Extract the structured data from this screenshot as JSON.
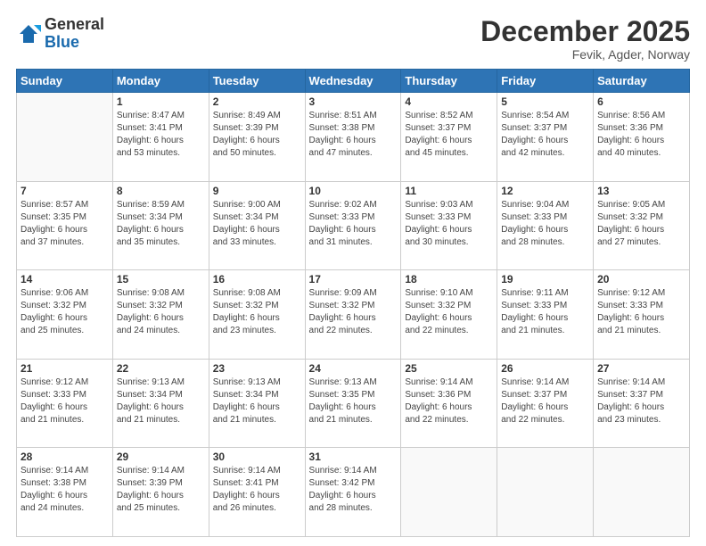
{
  "logo": {
    "line1": "General",
    "line2": "Blue"
  },
  "header": {
    "month": "December 2025",
    "location": "Fevik, Agder, Norway"
  },
  "days_of_week": [
    "Sunday",
    "Monday",
    "Tuesday",
    "Wednesday",
    "Thursday",
    "Friday",
    "Saturday"
  ],
  "weeks": [
    [
      {
        "day": "",
        "info": ""
      },
      {
        "day": "1",
        "info": "Sunrise: 8:47 AM\nSunset: 3:41 PM\nDaylight: 6 hours\nand 53 minutes."
      },
      {
        "day": "2",
        "info": "Sunrise: 8:49 AM\nSunset: 3:39 PM\nDaylight: 6 hours\nand 50 minutes."
      },
      {
        "day": "3",
        "info": "Sunrise: 8:51 AM\nSunset: 3:38 PM\nDaylight: 6 hours\nand 47 minutes."
      },
      {
        "day": "4",
        "info": "Sunrise: 8:52 AM\nSunset: 3:37 PM\nDaylight: 6 hours\nand 45 minutes."
      },
      {
        "day": "5",
        "info": "Sunrise: 8:54 AM\nSunset: 3:37 PM\nDaylight: 6 hours\nand 42 minutes."
      },
      {
        "day": "6",
        "info": "Sunrise: 8:56 AM\nSunset: 3:36 PM\nDaylight: 6 hours\nand 40 minutes."
      }
    ],
    [
      {
        "day": "7",
        "info": "Sunrise: 8:57 AM\nSunset: 3:35 PM\nDaylight: 6 hours\nand 37 minutes."
      },
      {
        "day": "8",
        "info": "Sunrise: 8:59 AM\nSunset: 3:34 PM\nDaylight: 6 hours\nand 35 minutes."
      },
      {
        "day": "9",
        "info": "Sunrise: 9:00 AM\nSunset: 3:34 PM\nDaylight: 6 hours\nand 33 minutes."
      },
      {
        "day": "10",
        "info": "Sunrise: 9:02 AM\nSunset: 3:33 PM\nDaylight: 6 hours\nand 31 minutes."
      },
      {
        "day": "11",
        "info": "Sunrise: 9:03 AM\nSunset: 3:33 PM\nDaylight: 6 hours\nand 30 minutes."
      },
      {
        "day": "12",
        "info": "Sunrise: 9:04 AM\nSunset: 3:33 PM\nDaylight: 6 hours\nand 28 minutes."
      },
      {
        "day": "13",
        "info": "Sunrise: 9:05 AM\nSunset: 3:32 PM\nDaylight: 6 hours\nand 27 minutes."
      }
    ],
    [
      {
        "day": "14",
        "info": "Sunrise: 9:06 AM\nSunset: 3:32 PM\nDaylight: 6 hours\nand 25 minutes."
      },
      {
        "day": "15",
        "info": "Sunrise: 9:08 AM\nSunset: 3:32 PM\nDaylight: 6 hours\nand 24 minutes."
      },
      {
        "day": "16",
        "info": "Sunrise: 9:08 AM\nSunset: 3:32 PM\nDaylight: 6 hours\nand 23 minutes."
      },
      {
        "day": "17",
        "info": "Sunrise: 9:09 AM\nSunset: 3:32 PM\nDaylight: 6 hours\nand 22 minutes."
      },
      {
        "day": "18",
        "info": "Sunrise: 9:10 AM\nSunset: 3:32 PM\nDaylight: 6 hours\nand 22 minutes."
      },
      {
        "day": "19",
        "info": "Sunrise: 9:11 AM\nSunset: 3:33 PM\nDaylight: 6 hours\nand 21 minutes."
      },
      {
        "day": "20",
        "info": "Sunrise: 9:12 AM\nSunset: 3:33 PM\nDaylight: 6 hours\nand 21 minutes."
      }
    ],
    [
      {
        "day": "21",
        "info": "Sunrise: 9:12 AM\nSunset: 3:33 PM\nDaylight: 6 hours\nand 21 minutes."
      },
      {
        "day": "22",
        "info": "Sunrise: 9:13 AM\nSunset: 3:34 PM\nDaylight: 6 hours\nand 21 minutes."
      },
      {
        "day": "23",
        "info": "Sunrise: 9:13 AM\nSunset: 3:34 PM\nDaylight: 6 hours\nand 21 minutes."
      },
      {
        "day": "24",
        "info": "Sunrise: 9:13 AM\nSunset: 3:35 PM\nDaylight: 6 hours\nand 21 minutes."
      },
      {
        "day": "25",
        "info": "Sunrise: 9:14 AM\nSunset: 3:36 PM\nDaylight: 6 hours\nand 22 minutes."
      },
      {
        "day": "26",
        "info": "Sunrise: 9:14 AM\nSunset: 3:37 PM\nDaylight: 6 hours\nand 22 minutes."
      },
      {
        "day": "27",
        "info": "Sunrise: 9:14 AM\nSunset: 3:37 PM\nDaylight: 6 hours\nand 23 minutes."
      }
    ],
    [
      {
        "day": "28",
        "info": "Sunrise: 9:14 AM\nSunset: 3:38 PM\nDaylight: 6 hours\nand 24 minutes."
      },
      {
        "day": "29",
        "info": "Sunrise: 9:14 AM\nSunset: 3:39 PM\nDaylight: 6 hours\nand 25 minutes."
      },
      {
        "day": "30",
        "info": "Sunrise: 9:14 AM\nSunset: 3:41 PM\nDaylight: 6 hours\nand 26 minutes."
      },
      {
        "day": "31",
        "info": "Sunrise: 9:14 AM\nSunset: 3:42 PM\nDaylight: 6 hours\nand 28 minutes."
      },
      {
        "day": "",
        "info": ""
      },
      {
        "day": "",
        "info": ""
      },
      {
        "day": "",
        "info": ""
      }
    ]
  ]
}
